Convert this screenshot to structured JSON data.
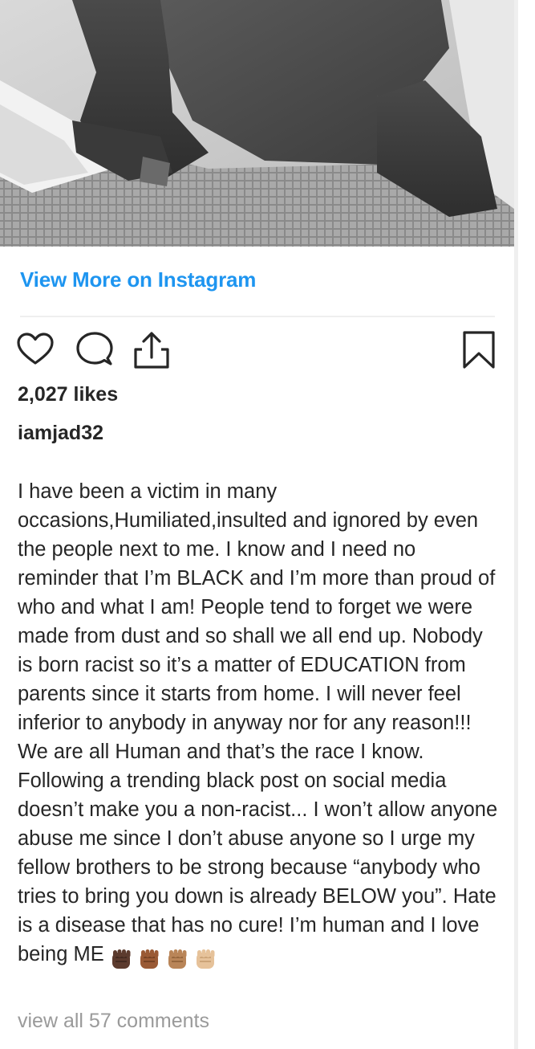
{
  "post": {
    "link_label": "View More on Instagram",
    "likes_text": "2,027 likes",
    "username": "iamjad32",
    "caption": "I have been a victim in many occasions,Humiliated,insulted and ignored by even the people next to me. I know and I need no reminder that I’m BLACK and I’m more than proud of who and what I am! People tend to forget we were made from dust and so shall we all end up. Nobody is born racist so it’s a matter of EDUCATION from parents since it starts from home. I will never feel inferior to anybody in anyway nor for any reason!!! We are all Human and that’s the race I know. Following a trending black post on social media doesn’t make you a non-racist... I won’t allow anyone abuse me since I don’t abuse anyone so I urge my fellow brothers to be strong because “anybody who tries to bring you down is already BELOW you”. Hate is a disease that has no cure! I’m human and I love being ME",
    "comments_link": "view all 57 comments"
  },
  "actions": {
    "like_icon": "heart-icon",
    "comment_icon": "comment-icon",
    "share_icon": "share-icon",
    "save_icon": "bookmark-icon"
  },
  "emojis": [
    {
      "name": "raised-fist-dark-skin-tone",
      "color": "#5c3b2e"
    },
    {
      "name": "raised-fist-medium-dark-skin-tone",
      "color": "#9a5a35"
    },
    {
      "name": "raised-fist-medium-skin-tone",
      "color": "#b98558"
    },
    {
      "name": "raised-fist-medium-light-skin-tone",
      "color": "#e6c29a"
    }
  ],
  "colors": {
    "link_blue": "#1e95f0",
    "text": "#262626",
    "muted": "#9a9a9a"
  }
}
